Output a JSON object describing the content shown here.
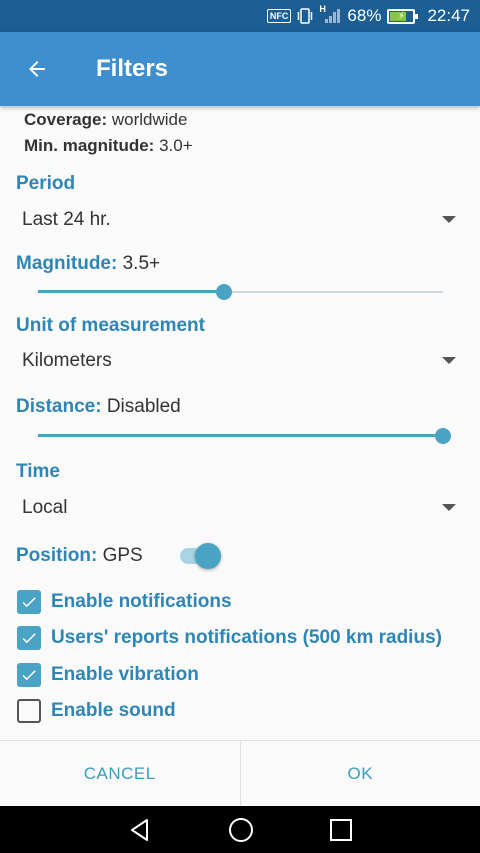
{
  "status_bar": {
    "nfc": "NFC",
    "network": "H",
    "battery_percent": "68%",
    "time": "22:47"
  },
  "app_bar": {
    "title": "Filters"
  },
  "coverage": {
    "label": "Coverage:",
    "value": "worldwide"
  },
  "min_magnitude": {
    "label": "Min. magnitude:",
    "value": "3.0+"
  },
  "period": {
    "label": "Period",
    "selected": "Last 24 hr."
  },
  "magnitude": {
    "label": "Magnitude:",
    "value": "3.5+",
    "slider_fraction": 0.46
  },
  "unit": {
    "label": "Unit of measurement",
    "selected": "Kilometers"
  },
  "distance": {
    "label": "Distance:",
    "value": "Disabled",
    "slider_fraction": 1.0
  },
  "time": {
    "label": "Time",
    "selected": "Local"
  },
  "position": {
    "label": "Position:",
    "value": "GPS",
    "enabled": true
  },
  "checkboxes": [
    {
      "label": "Enable notifications",
      "checked": true
    },
    {
      "label": "Users' reports notifications (500 km radius)",
      "checked": true
    },
    {
      "label": "Enable vibration",
      "checked": true
    },
    {
      "label": "Enable sound",
      "checked": false
    }
  ],
  "dialog_buttons": {
    "cancel": "CANCEL",
    "ok": "OK"
  },
  "colors": {
    "app_bar": "#3f8fcf",
    "accent": "#4aa3c4",
    "label": "#2f86b4"
  }
}
